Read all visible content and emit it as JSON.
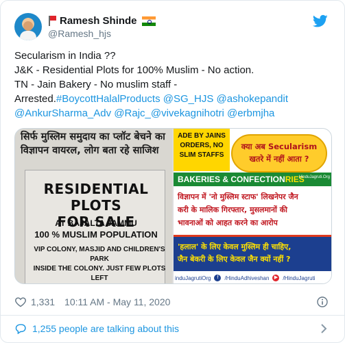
{
  "author": {
    "name": "Ramesh Shinde",
    "handle": "@Ramesh_hjs"
  },
  "tweet": {
    "line1": "Secularism in India ??",
    "line2": "J&K - Residential Plots for 100% Muslim - No action.",
    "line3": "TN - Jain Bakery - No muslim staff -",
    "line4_plain": "Arrested.",
    "line4_links": "#BoycottHalalProducts @SG_HJS @ashokepandit",
    "line5_links": "@AnkurSharma_Adv @Rajc_@vivekagnihotri @erbmjha"
  },
  "media": {
    "left": {
      "hindi_headline": "सिर्फ मुस्लिम समुदाय का प्लॉट बेचने का विज्ञापन वायरल, लोग बता रहे साजिश",
      "ad_title_line1": "RESIDENTIAL PLOTS",
      "ad_title_line2": "FOR SALE",
      "ad_location": "AT BAJALTA JAMMU",
      "ad_population": "100 % MUSLIM POPULATION",
      "ad_detail_line1": "VIP COLONY, MASJID AND CHILDREN'S PARK",
      "ad_detail_line2": "INSIDE THE COLONY. JUST FEW PLOTS LEFT"
    },
    "right": {
      "badge_line1": "ADE BY JAINS",
      "badge_line2": "ORDERS, NO",
      "badge_line3": "SLIM STAFFS",
      "cloud_line1": "क्या अब Secularism",
      "cloud_line2": "खतरे में नहीं आता ?",
      "band_left": "BAKERIES & CONFECTION",
      "band_right": "RIES",
      "band_small": "HinduJagruti.Org",
      "red_line1": "विज्ञापन में 'नो मुस्लिम स्टाफ' लिखनेपर जैन",
      "red_line2": "करी के मालिक गिरफ्तार, मुसलमानों की",
      "red_line3": "भावनाओं को आहत करने का आरोप",
      "blue_line1": "'हलाल' के लिए केवल मुस्लिम ही चाहिए,",
      "blue_line2": "जैन बेकरी के लिए केवल जैन क्यों नहीं ?",
      "social1": "induJagrutiOrg",
      "social2": "/HinduAdhiveshan",
      "social3": "/HinduJagruti"
    }
  },
  "footer": {
    "likes": "1,331",
    "timestamp": "10:11 AM - May 11, 2020",
    "talking": "1,255 people are talking about this"
  },
  "colors": {
    "link": "#1b95e0",
    "muted": "#657786",
    "border": "#e1e8ed"
  }
}
